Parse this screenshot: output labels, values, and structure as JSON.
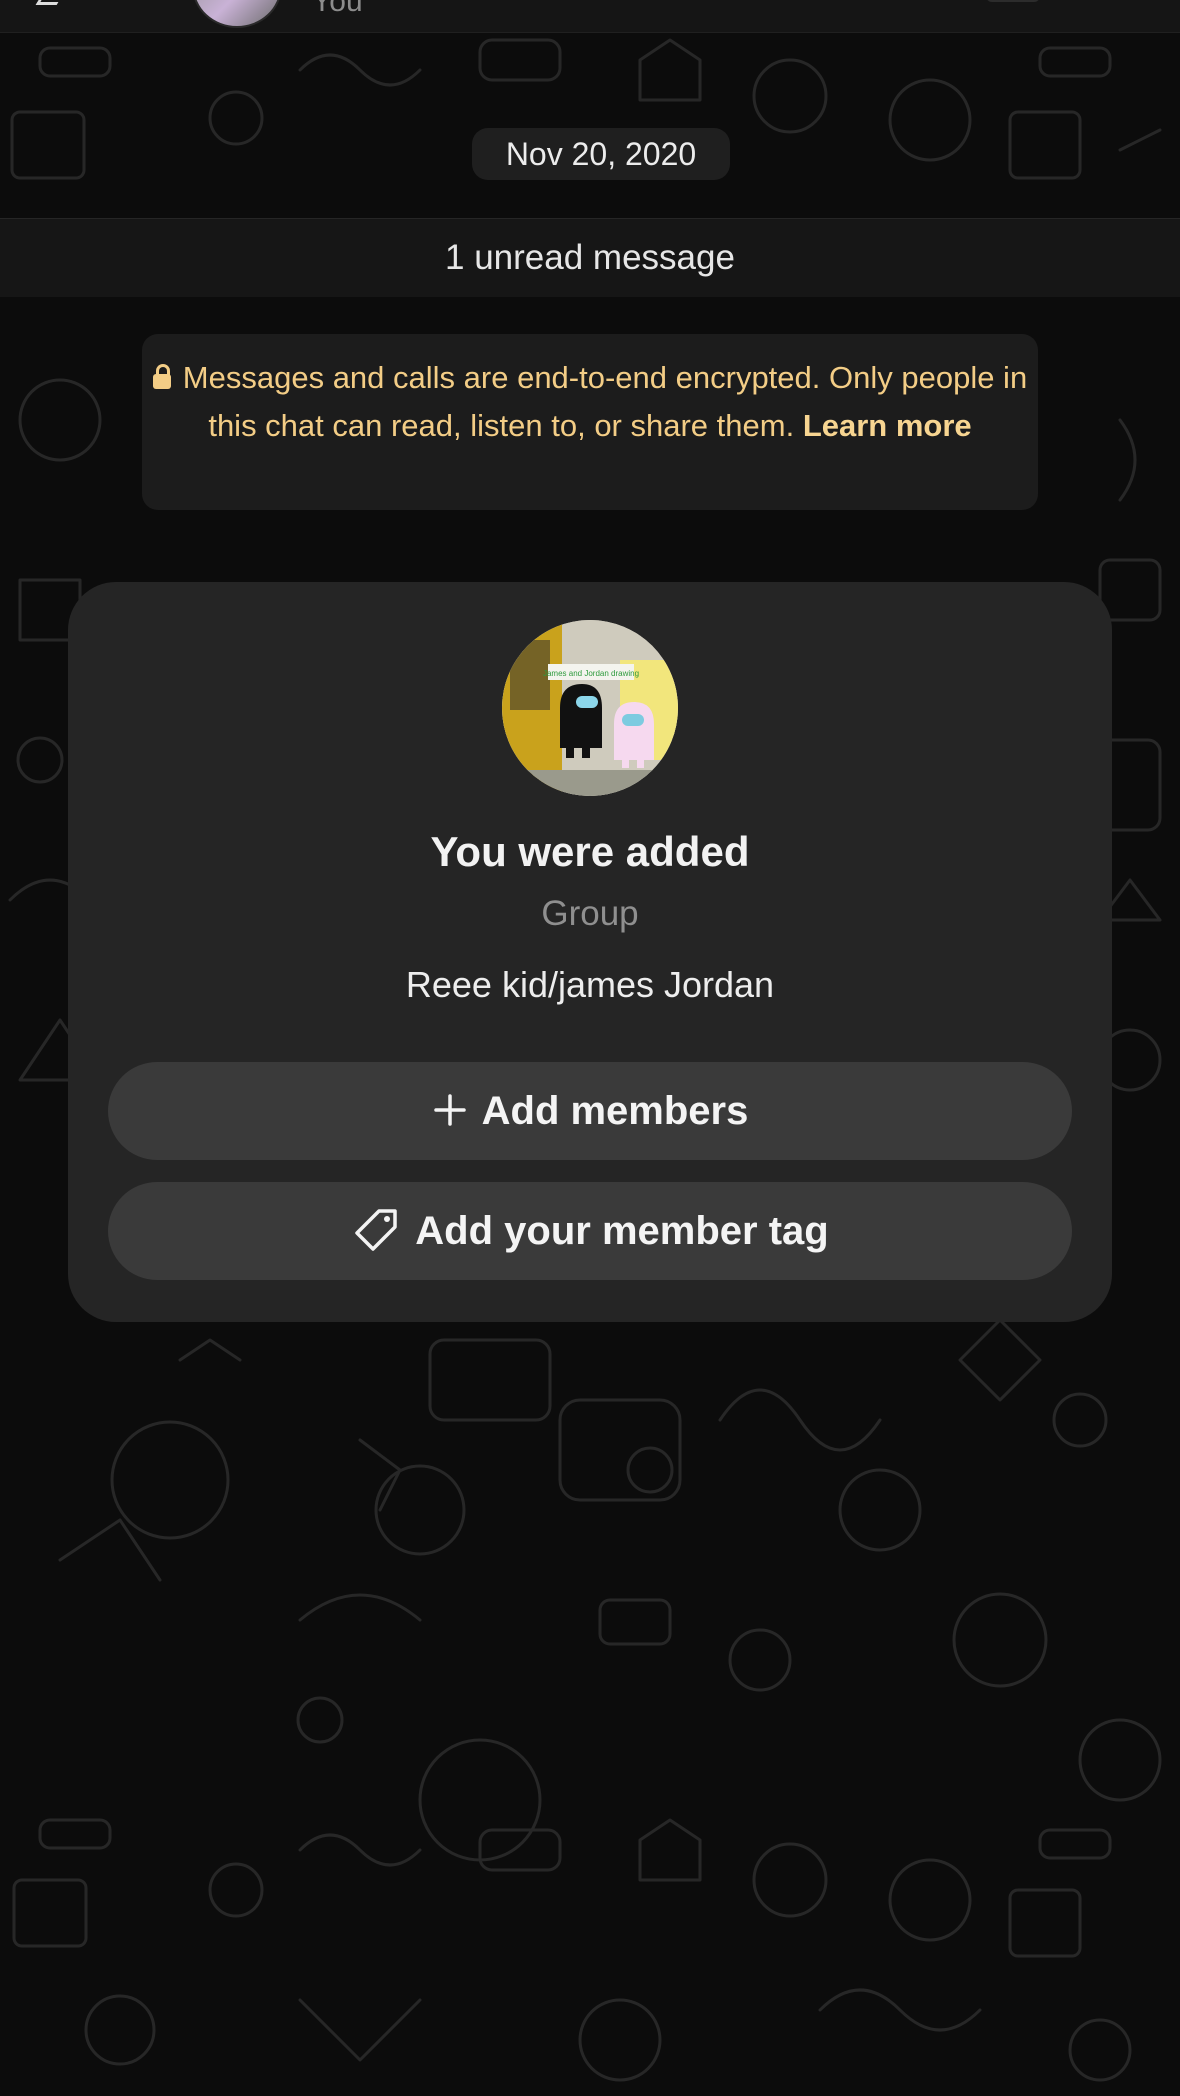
{
  "header": {
    "subtitle": "You"
  },
  "chat": {
    "date_label": "Nov 20, 2020",
    "unread_label": "1 unread message",
    "encryption": {
      "text": "Messages and calls are end-to-end encrypted. Only people in this chat can read, listen to, or share them.",
      "link_label": "Learn more",
      "color": "#f3cd86"
    }
  },
  "group_card": {
    "title": "You were added",
    "type_label": "Group",
    "group_name": "Reee kid/james Jordan",
    "avatar_caption": "James and Jordan drawing",
    "add_members_label": "Add members",
    "member_tag_label": "Add your member tag"
  },
  "icons": {
    "lock": "lock-icon",
    "plus": "plus-icon",
    "tag": "tag-icon"
  },
  "theme": {
    "background": "#0c0c0c",
    "card": "#252525",
    "button": "#3a3a3a",
    "accent_text": "#f3cd86"
  }
}
